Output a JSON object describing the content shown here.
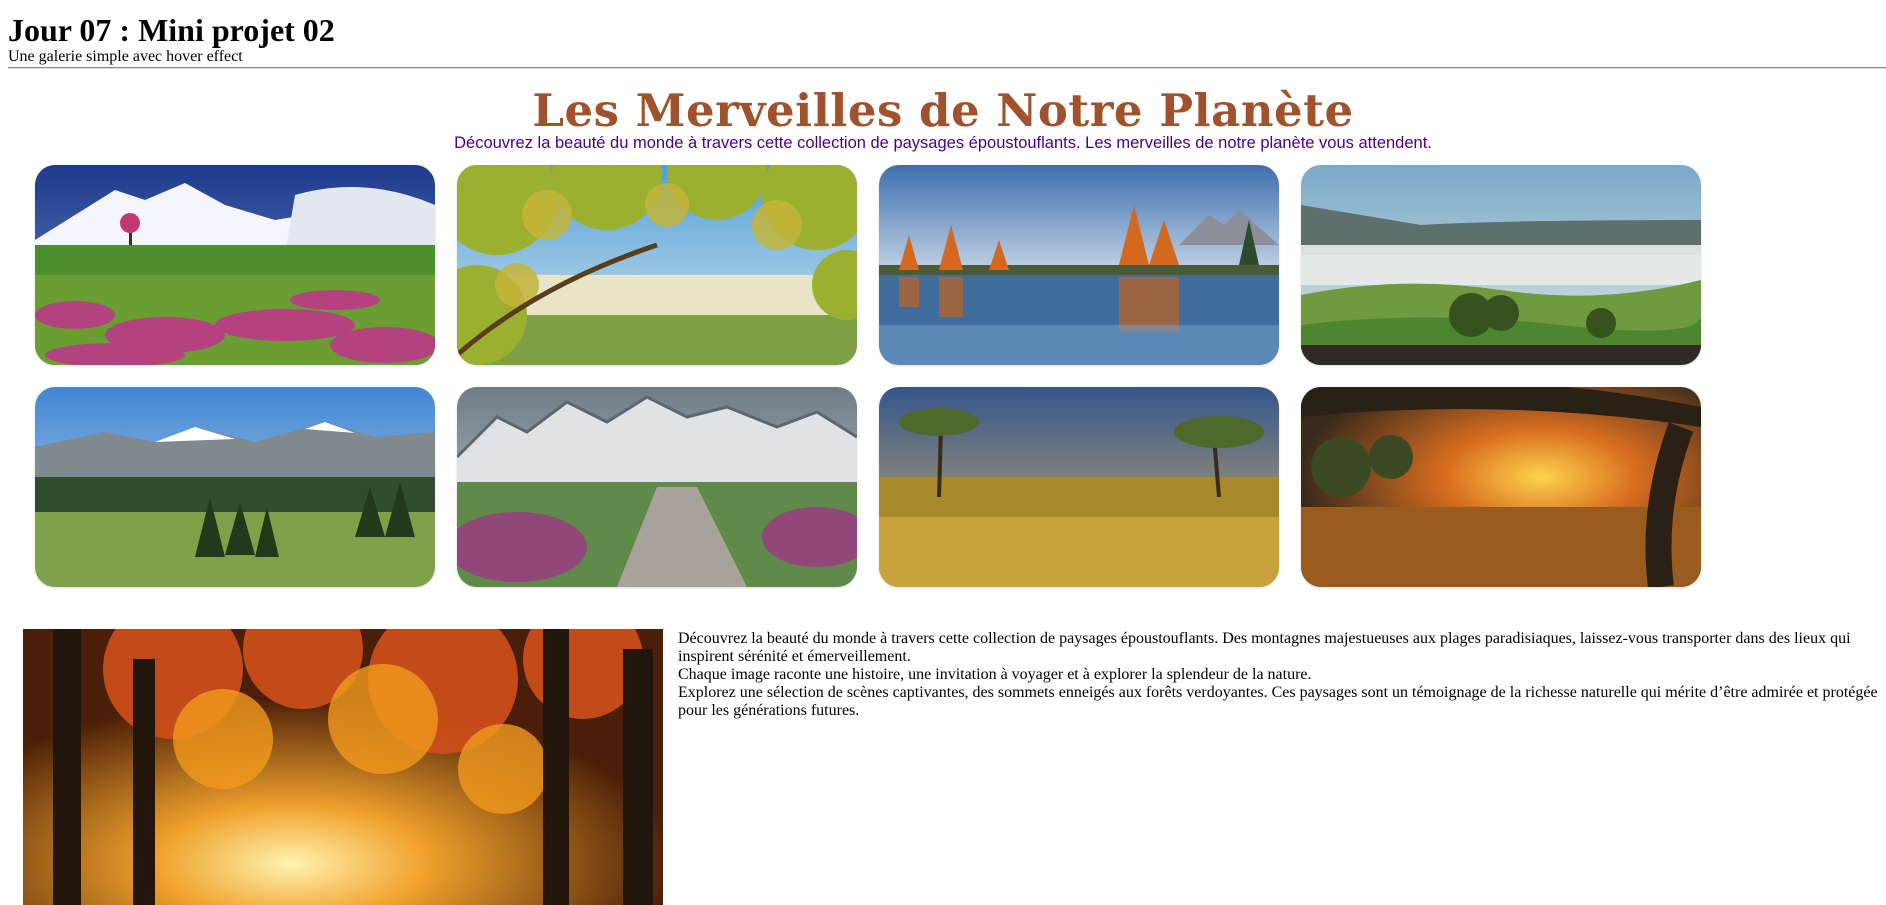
{
  "header": {
    "title": "Jour 07 : Mini projet 02",
    "subtitle": "Une galerie simple avec hover effect"
  },
  "gallery": {
    "title": "Les Merveilles de Notre Planète",
    "intro": "Découvrez la beauté du monde à travers cette collection de paysages époustouflants. Les merveilles de notre planète vous attendent.",
    "title_color": "#a0522d",
    "intro_color": "#4b0082",
    "images": [
      {
        "name": "snowy-mountain-flower-meadow"
      },
      {
        "name": "tree-branches-over-misty-valley"
      },
      {
        "name": "autumn-lake-reflection"
      },
      {
        "name": "misty-green-hills"
      },
      {
        "name": "alpine-valley-pine-forest"
      },
      {
        "name": "stone-path-mountains-heather"
      },
      {
        "name": "savanna-trees-golden-grass"
      },
      {
        "name": "sunset-under-oak-tree"
      }
    ]
  },
  "story": {
    "image_name": "autumn-forest-path",
    "paragraphs": [
      "Découvrez la beauté du monde à travers cette collection de paysages époustouflants. Des montagnes majestueuses aux plages paradisiaques, laissez-vous transporter dans des lieux qui inspirent sérénité et émerveillement.",
      "Chaque image raconte une histoire, une invitation à voyager et à explorer la splendeur de la nature.",
      "Explorez une sélection de scènes captivantes, des sommets enneigés aux forêts verdoyantes. Ces paysages sont un témoignage de la richesse naturelle qui mérite d’être admirée et protégée pour les générations futures."
    ]
  }
}
